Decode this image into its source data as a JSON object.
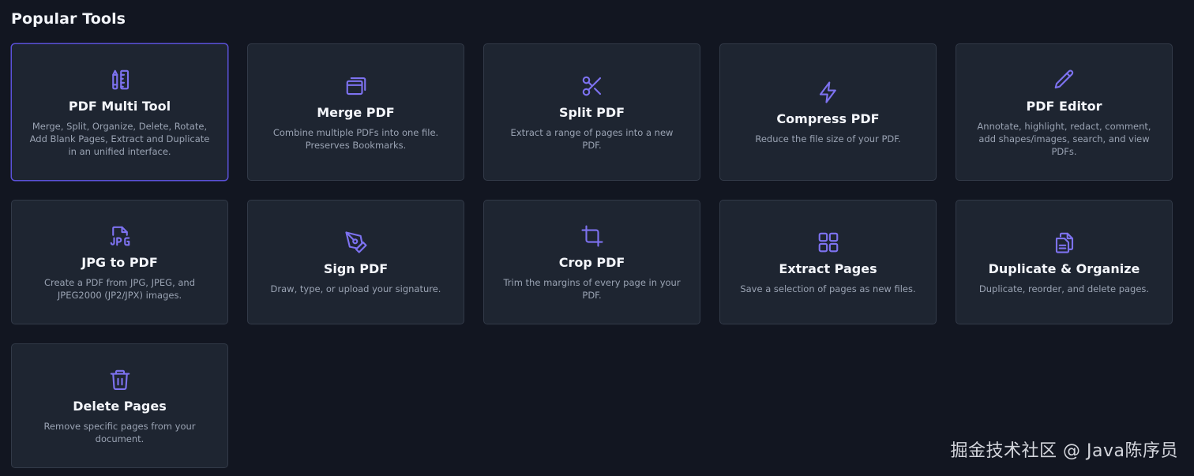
{
  "section": {
    "title": "Popular Tools"
  },
  "colors": {
    "accent": "#7d72f0",
    "card_bg": "#1e2531",
    "page_bg": "#121621",
    "active_border": "#5b51d8"
  },
  "tools": [
    {
      "icon": "ruler-pencil-icon",
      "title": "PDF Multi Tool",
      "description": "Merge, Split, Organize, Delete, Rotate, Add Blank Pages, Extract and Duplicate in an unified interface."
    },
    {
      "icon": "stacked-windows-icon",
      "title": "Merge PDF",
      "description": "Combine multiple PDFs into one file. Preserves Bookmarks."
    },
    {
      "icon": "scissors-icon",
      "title": "Split PDF",
      "description": "Extract a range of pages into a new PDF."
    },
    {
      "icon": "lightning-bolt-icon",
      "title": "Compress PDF",
      "description": "Reduce the file size of your PDF."
    },
    {
      "icon": "pencil-icon",
      "title": "PDF Editor",
      "description": "Annotate, highlight, redact, comment, add shapes/images, search, and view PDFs."
    },
    {
      "icon": "jpg-file-icon",
      "title": "JPG to PDF",
      "description": "Create a PDF from JPG, JPEG, and JPEG2000 (JP2/JPX) images."
    },
    {
      "icon": "pen-nib-icon",
      "title": "Sign PDF",
      "description": "Draw, type, or upload your signature."
    },
    {
      "icon": "crop-icon",
      "title": "Crop PDF",
      "description": "Trim the margins of every page in your PDF."
    },
    {
      "icon": "grid-squares-icon",
      "title": "Extract Pages",
      "description": "Save a selection of pages as new files."
    },
    {
      "icon": "copy-document-icon",
      "title": "Duplicate & Organize",
      "description": "Duplicate, reorder, and delete pages."
    },
    {
      "icon": "trash-icon",
      "title": "Delete Pages",
      "description": "Remove specific pages from your document."
    }
  ],
  "watermark": {
    "text": "掘金技术社区 @ Java陈序员"
  }
}
